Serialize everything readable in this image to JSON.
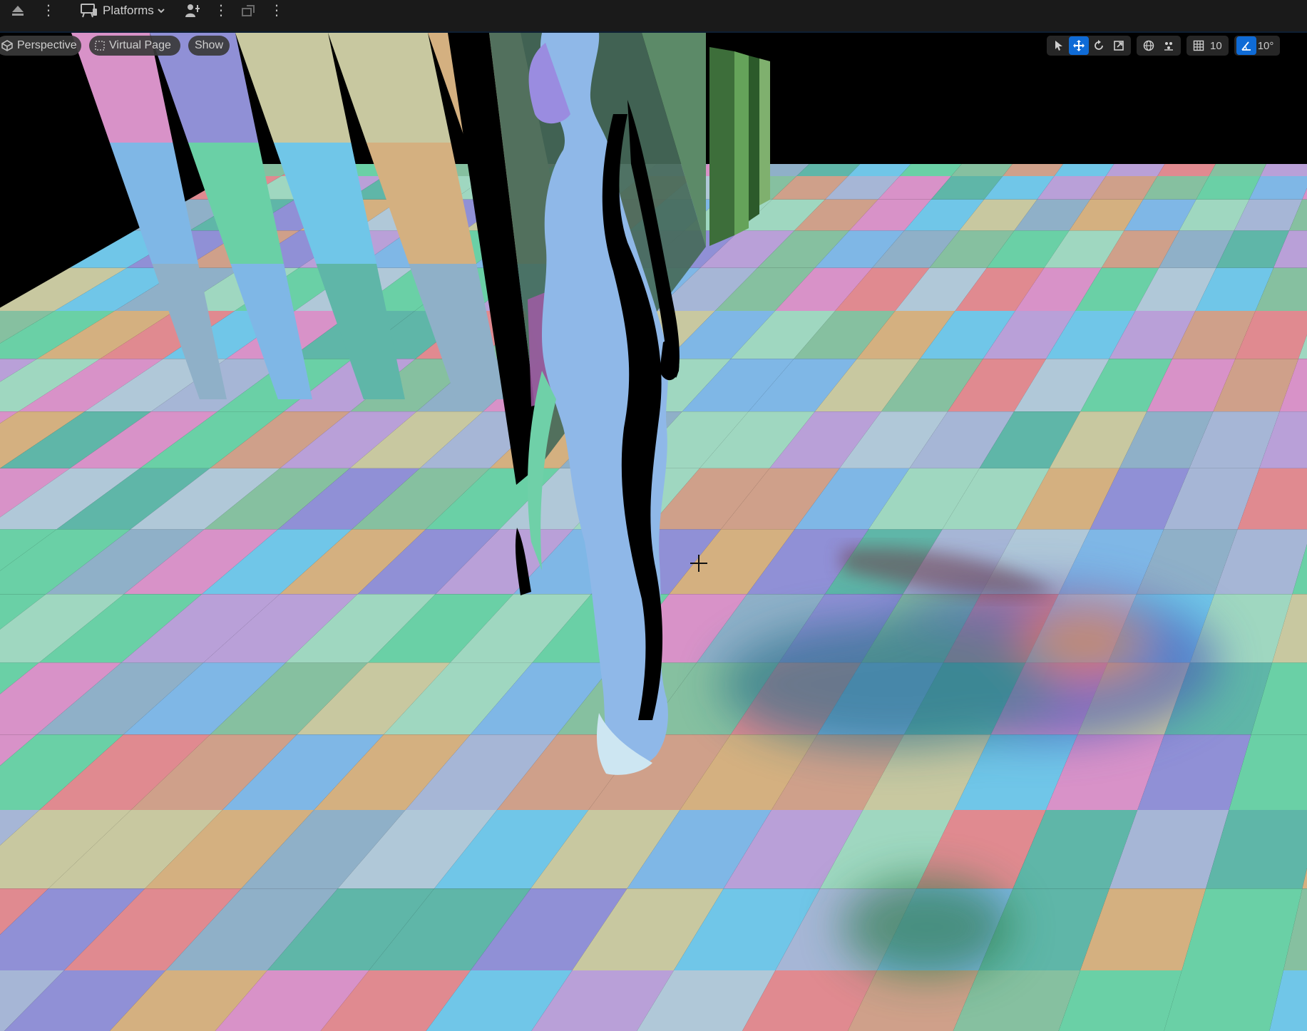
{
  "toolbar": {
    "platforms_label": "Platforms",
    "icons": [
      "eject-icon",
      "platforms-icon",
      "chevron-down-icon",
      "user-icon",
      "more-icon"
    ]
  },
  "viewport": {
    "view_mode_label": "Perspective",
    "virtual_page_label": "Virtual Page",
    "show_label": "Show",
    "grid_snap_value": "10",
    "rotation_snap_value": "10°",
    "active_tool": "translate",
    "accent_color": "#0f6bd6"
  }
}
